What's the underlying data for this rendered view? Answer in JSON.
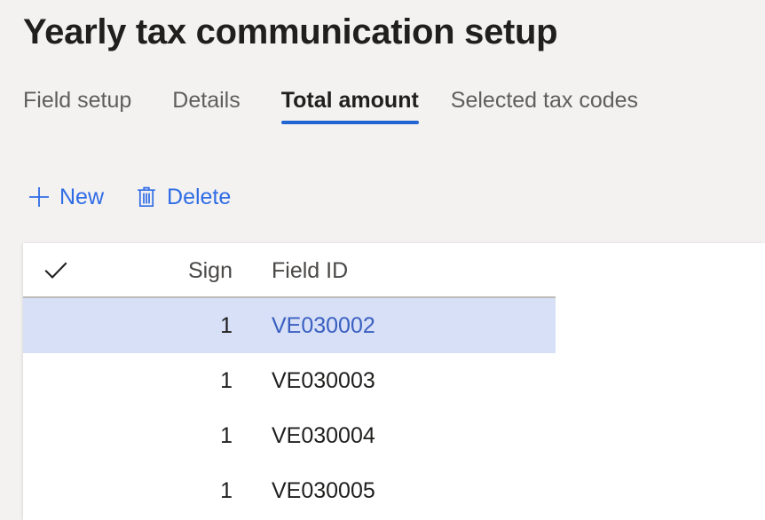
{
  "page": {
    "title": "Yearly tax communication setup",
    "background_color": "#f3f2f1",
    "accent_color": "#2264d1"
  },
  "tabs": [
    {
      "label": "Field setup",
      "active": false
    },
    {
      "label": "Details",
      "active": false
    },
    {
      "label": "Total amount",
      "active": true
    },
    {
      "label": "Selected tax codes",
      "active": false
    }
  ],
  "toolbar": {
    "new_label": "New",
    "new_icon": "plus-icon",
    "delete_label": "Delete",
    "delete_icon": "trash-icon",
    "link_color": "#2f6ce5"
  },
  "grid": {
    "select_all_icon": "checkmark-icon",
    "columns": [
      {
        "key": "sign",
        "label": "Sign"
      },
      {
        "key": "field_id",
        "label": "Field ID"
      }
    ],
    "selection_color": "#d7e0f7",
    "rows": [
      {
        "sign": "1",
        "field_id": "VE030002",
        "selected": true
      },
      {
        "sign": "1",
        "field_id": "VE030003",
        "selected": false
      },
      {
        "sign": "1",
        "field_id": "VE030004",
        "selected": false
      },
      {
        "sign": "1",
        "field_id": "VE030005",
        "selected": false
      }
    ]
  }
}
